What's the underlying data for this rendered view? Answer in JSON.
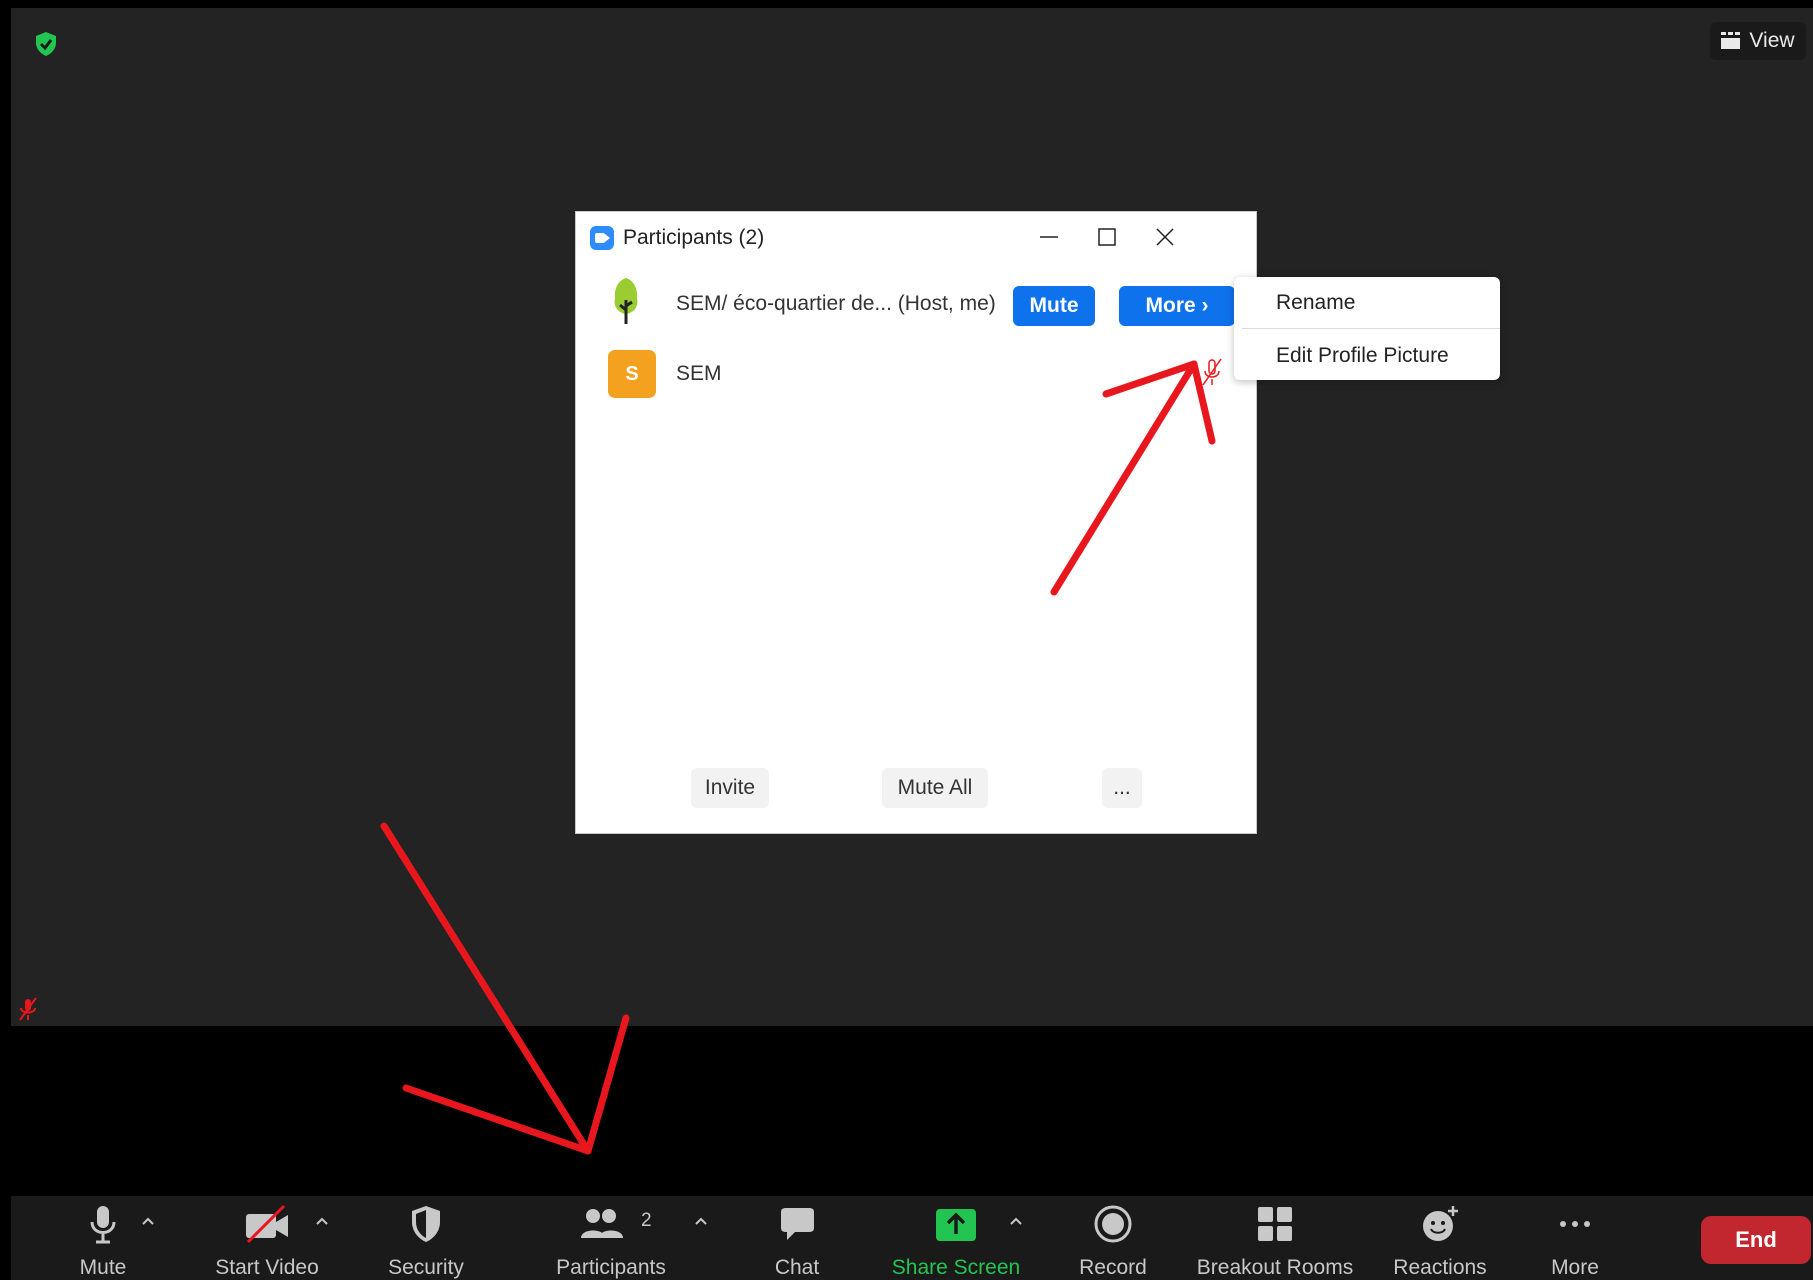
{
  "meeting": {
    "view_label": "View"
  },
  "participants_window": {
    "title": "Participants (2)",
    "participants": [
      {
        "name": "SEM/ éco-quartier de... (Host, me)",
        "mute_label": "Mute",
        "more_label": "More ›"
      },
      {
        "name": "SEM",
        "avatar_letter": "S"
      }
    ],
    "footer": {
      "invite_label": "Invite",
      "mute_all_label": "Mute All",
      "more_label": "..."
    }
  },
  "context_menu": {
    "items": [
      "Rename",
      "Edit Profile Picture"
    ]
  },
  "toolbar": {
    "mute": "Mute",
    "start_video": "Start Video",
    "security": "Security",
    "participants": "Participants",
    "participants_count": "2",
    "chat": "Chat",
    "share_screen": "Share Screen",
    "record": "Record",
    "breakout_rooms": "Breakout Rooms",
    "reactions": "Reactions",
    "more": "More",
    "end": "End"
  },
  "colors": {
    "stage_bg": "#232323",
    "toolbar_bg": "#1a1a1a",
    "accent_blue": "#0e72ed",
    "share_green": "#23c552",
    "end_red": "#c2262f",
    "annotation_red": "#e8171e",
    "avatar_orange": "#f3a11f"
  }
}
